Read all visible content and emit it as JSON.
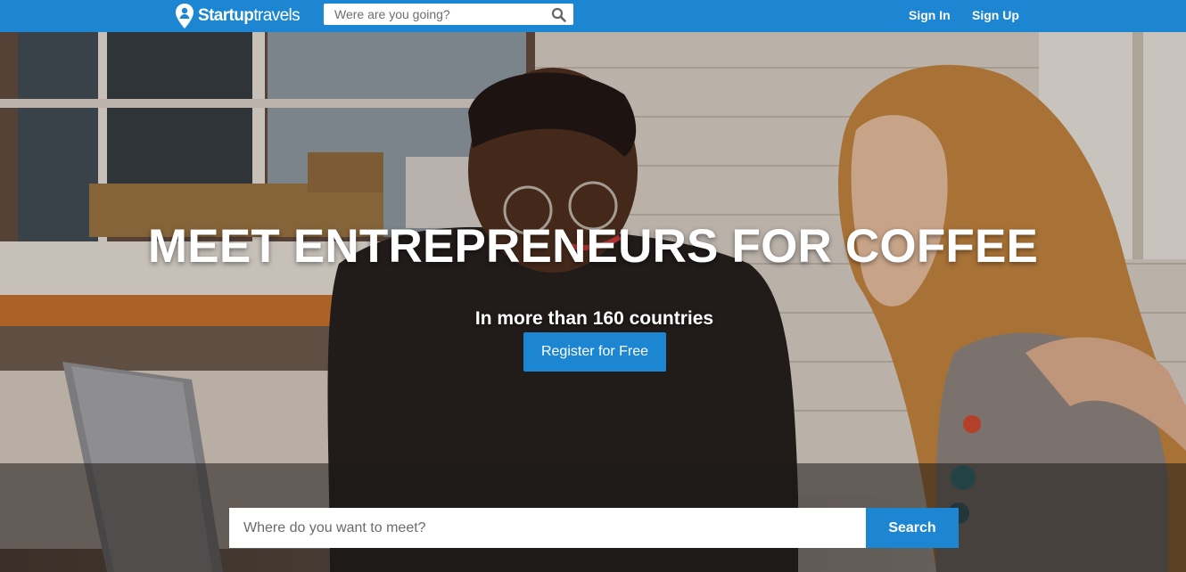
{
  "navbar": {
    "logo": {
      "text_part1": "Startup",
      "text_part2": "travels",
      "icon": "map-pin-person-icon"
    },
    "search": {
      "placeholder": "Were are you going?",
      "icon": "search-icon"
    },
    "links": {
      "sign_in": "Sign In",
      "sign_up": "Sign Up"
    }
  },
  "hero": {
    "title": "MEET ENTREPRENEURS FOR COFFEE",
    "subtitle": "In more than 160 countries",
    "register_label": "Register for Free"
  },
  "meet_search": {
    "placeholder": "Where do you want to meet?",
    "button_label": "Search"
  },
  "colors": {
    "brand_blue": "#1d86d2",
    "text_on_brand": "#ffffff"
  }
}
